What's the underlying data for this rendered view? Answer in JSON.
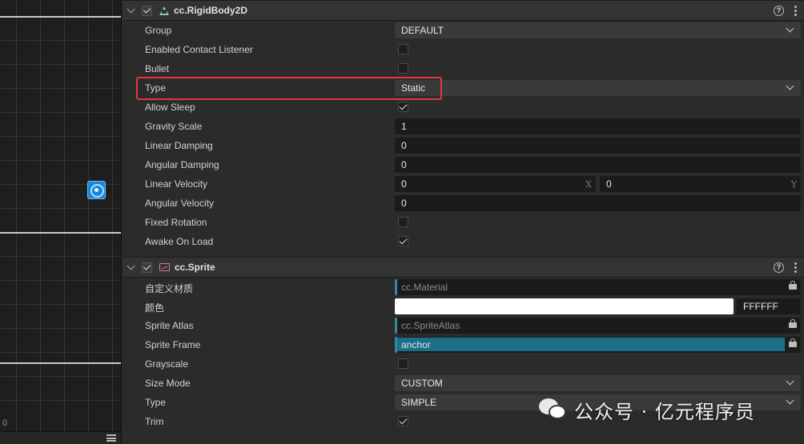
{
  "scene": {
    "zero_label": "0"
  },
  "rigidbody": {
    "title": "cc.RigidBody2D",
    "props": {
      "group": {
        "label": "Group",
        "value": "DEFAULT"
      },
      "contact_listener": {
        "label": "Enabled Contact Listener",
        "checked": false
      },
      "bullet": {
        "label": "Bullet",
        "checked": false
      },
      "type": {
        "label": "Type",
        "value": "Static"
      },
      "allow_sleep": {
        "label": "Allow Sleep",
        "checked": true
      },
      "gravity_scale": {
        "label": "Gravity Scale",
        "value": "1"
      },
      "linear_damping": {
        "label": "Linear Damping",
        "value": "0"
      },
      "angular_damping": {
        "label": "Angular Damping",
        "value": "0"
      },
      "linear_velocity": {
        "label": "Linear Velocity",
        "x": "0",
        "y": "0",
        "x_axis": "X",
        "y_axis": "Y"
      },
      "angular_velocity": {
        "label": "Angular Velocity",
        "value": "0"
      },
      "fixed_rotation": {
        "label": "Fixed Rotation",
        "checked": false
      },
      "awake_on_load": {
        "label": "Awake On Load",
        "checked": true
      }
    }
  },
  "sprite": {
    "title": "cc.Sprite",
    "props": {
      "material": {
        "label": "自定义材质",
        "value": "cc.Material"
      },
      "color": {
        "label": "颜色",
        "hex": "FFFFFF",
        "swatch": "#ffffff"
      },
      "atlas": {
        "label": "Sprite Atlas",
        "value": "cc.SpriteAtlas"
      },
      "frame": {
        "label": "Sprite Frame",
        "value": "anchor"
      },
      "grayscale": {
        "label": "Grayscale",
        "checked": false
      },
      "size_mode": {
        "label": "Size Mode",
        "value": "CUSTOM"
      },
      "type": {
        "label": "Type",
        "value": "SIMPLE"
      },
      "trim": {
        "label": "Trim",
        "checked": true
      }
    }
  },
  "watermark": {
    "text": "公众号 · 亿元程序员"
  },
  "colors": {
    "highlight": "#e3373c",
    "asset_accent": "#2f8aa3",
    "sprite_frame_fill": "#1d6e88"
  },
  "icons": {
    "help": "?",
    "rigidbody": "rigidbody-triangle-icon",
    "sprite": "sprite-image-icon",
    "lock": "lock-icon"
  }
}
